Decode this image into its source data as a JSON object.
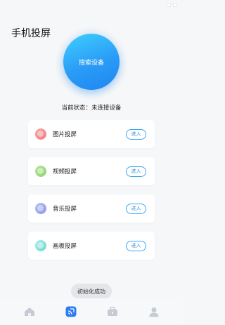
{
  "page": {
    "title": "手机投屏"
  },
  "search": {
    "label": "搜索设备"
  },
  "status": {
    "prefix": "当前状态：",
    "value": "未连接设备"
  },
  "cards": [
    {
      "label": "图片投屏",
      "button": "进入",
      "icon": "image-icon",
      "colors": [
        "#f5a3a3",
        "#f47f7f"
      ]
    },
    {
      "label": "视频投屏",
      "button": "进入",
      "icon": "video-icon",
      "colors": [
        "#b7e39a",
        "#8fd46d"
      ]
    },
    {
      "label": "音乐投屏",
      "button": "进入",
      "icon": "music-icon",
      "colors": [
        "#b4bdf4",
        "#8c98ec"
      ]
    },
    {
      "label": "画板投屏",
      "button": "进入",
      "icon": "drawing-board-icon",
      "colors": [
        "#a8ece6",
        "#6dd9cf"
      ]
    }
  ],
  "toast": {
    "text": "初始化成功"
  },
  "tabbar": {
    "items": [
      {
        "name": "home",
        "icon": "home-icon",
        "active": false
      },
      {
        "name": "cast",
        "icon": "cast-icon",
        "active": true
      },
      {
        "name": "toolbox",
        "icon": "toolbox-icon",
        "active": false
      },
      {
        "name": "profile",
        "icon": "profile-icon",
        "active": false
      }
    ]
  },
  "colors": {
    "accent": "#2a9bf6",
    "background": "#f6f7f9",
    "inactive_icon": "#c5cad3"
  }
}
